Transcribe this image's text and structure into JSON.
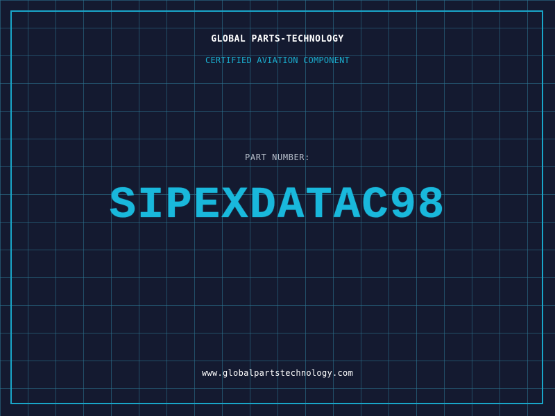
{
  "header": {
    "company": "GLOBAL PARTS-TECHNOLOGY",
    "subtitle": "CERTIFIED AVIATION COMPONENT"
  },
  "part": {
    "label": "PART NUMBER:",
    "number": "SIPEXDATAC98"
  },
  "footer": {
    "website": "www.globalpartstechnology.com"
  },
  "colors": {
    "background": "#141a30",
    "grid": "#2d7896",
    "accent": "#19b8dc",
    "frame": "#19a6c9",
    "text_primary": "#ffffff",
    "text_muted": "#b8c0cc"
  }
}
